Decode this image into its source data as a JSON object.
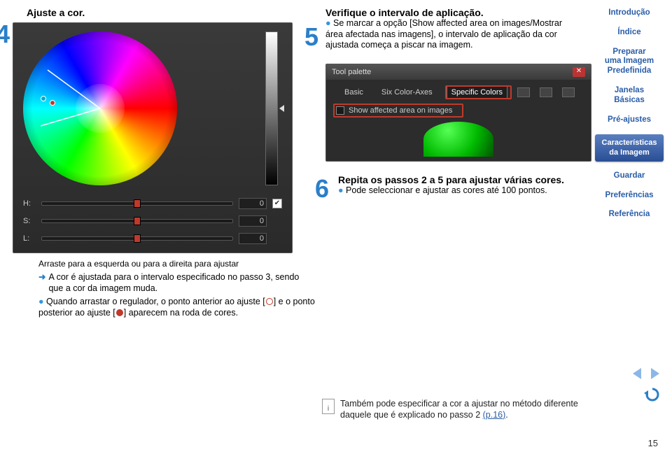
{
  "step4": {
    "num": "4",
    "title": "Ajuste a cor.",
    "panel": {
      "H_label": "H:",
      "H_value": "0",
      "S_label": "S:",
      "S_value": "0",
      "L_label": "L:",
      "L_value": "0"
    }
  },
  "step5": {
    "num": "5",
    "title": "Verifique o intervalo de aplicação.",
    "body": "Se marcar a opção [Show affected area on images/Mostrar área afectada nas imagens], o intervalo de aplicação da cor ajustada começa a piscar na imagem.",
    "toolpal_title": "Tool palette",
    "tab_basic": "Basic",
    "tab_six": "Six Color-Axes",
    "tab_specific": "Specific Colors",
    "checkbox_label": "Show affected area on images"
  },
  "step6": {
    "num": "6",
    "title": "Repita os passos 2 a 5 para ajustar várias cores.",
    "body": "Pode seleccionar e ajustar as cores até 100 pontos."
  },
  "caption": "Arraste para a esquerda ou para a direita para ajustar",
  "arrow_text": "A cor é ajustada para o intervalo especificado no passo 3, sendo que a cor da imagem muda.",
  "bullet_text_a": "Quando arrastar o regulador, o ponto anterior ao ajuste [",
  "bullet_text_b": "] e o ponto posterior ao ajuste [",
  "bullet_text_c": "] aparecem na roda de cores.",
  "sidebar": [
    {
      "type": "link",
      "label": "Introdução"
    },
    {
      "type": "link",
      "label": "Índice"
    },
    {
      "type": "link",
      "label": "Preparar\numa Imagem\nPredefinida"
    },
    {
      "type": "link",
      "label": "Janelas\nBásicas"
    },
    {
      "type": "link",
      "label": "Pré-ajustes"
    },
    {
      "type": "btn",
      "label": "Características\nda Imagem"
    },
    {
      "type": "link",
      "label": "Guardar"
    },
    {
      "type": "link",
      "label": "Preferências"
    },
    {
      "type": "link",
      "label": "Referência"
    }
  ],
  "tip": {
    "text_a": "Também pode especificar a cor a ajustar no método diferente daquele que é explicado no passo 2 ",
    "link": "(p.16)",
    "text_b": "."
  },
  "page_number": "15"
}
